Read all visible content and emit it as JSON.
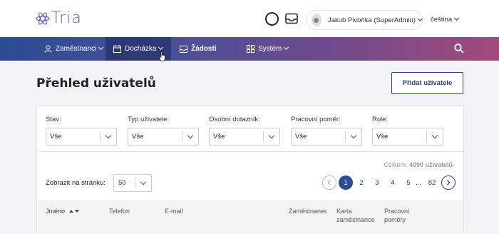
{
  "app": {
    "logo_text": "Tria"
  },
  "header": {
    "user_name": "Jakub Pivoňka (SuperAdmin)",
    "language": "čeština"
  },
  "nav": {
    "items": [
      {
        "label": "Zaměstnanci"
      },
      {
        "label": "Docházka"
      },
      {
        "label": "Žádosti"
      },
      {
        "label": "Systém"
      }
    ]
  },
  "page": {
    "title": "Přehled uživatelů",
    "add_button": "Přidat uživatele"
  },
  "filters": [
    {
      "label": "Stav:",
      "value": "Vše"
    },
    {
      "label": "Typ uživatele:",
      "value": "Vše"
    },
    {
      "label": "Osobní dotazník:",
      "value": "Vše"
    },
    {
      "label": "Pracovní poměr:",
      "value": "Vše"
    },
    {
      "label": "Role:",
      "value": "Vše"
    }
  ],
  "summary": {
    "prefix": "Celkem:",
    "total": "4090 uživatelů"
  },
  "pagination": {
    "per_page_label": "Zobrazit na stránku:",
    "per_page_value": "50",
    "pages": [
      "1",
      "2",
      "3",
      "4",
      "5"
    ],
    "ellipsis": "...",
    "last_page": "82",
    "current": "1"
  },
  "table": {
    "columns": [
      {
        "label": "Jméno"
      },
      {
        "label": "Telefon"
      },
      {
        "label": "E-mail"
      },
      {
        "label": "Zaměstnanec"
      },
      {
        "label": "Karta zaměstnance"
      },
      {
        "label": "Pracovní poměry"
      }
    ]
  },
  "colors": {
    "brand_dark": "#2b3f73",
    "accent": "#2b4c93",
    "logo": "#6a55a8"
  }
}
